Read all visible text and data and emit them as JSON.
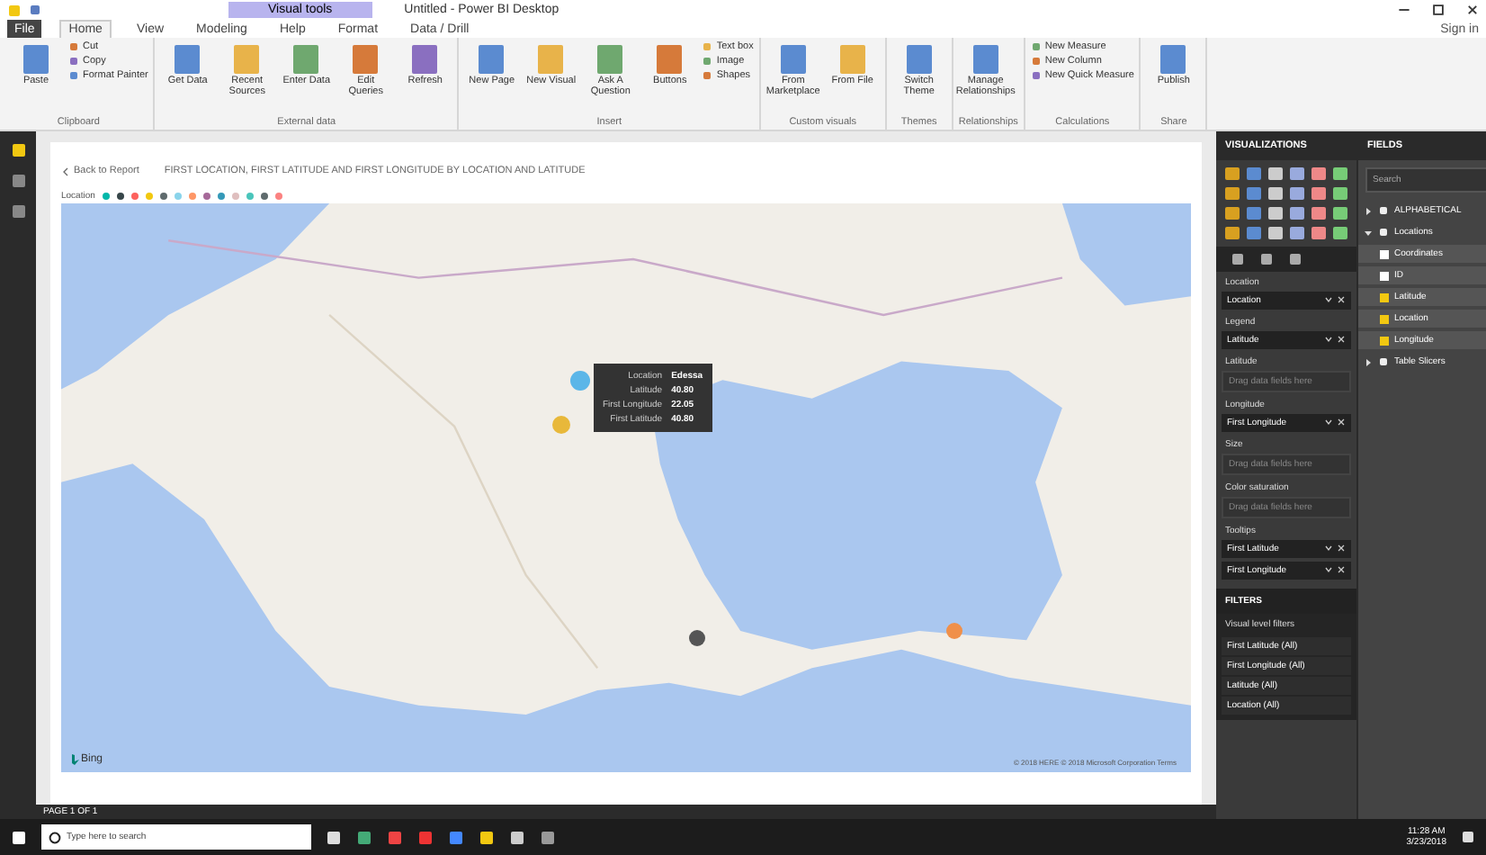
{
  "window": {
    "title": "Untitled - Power BI Desktop",
    "context_tab": "Visual tools",
    "sign_in": "Sign in"
  },
  "tabs": [
    {
      "label": "File",
      "selected": false
    },
    {
      "label": "Home",
      "selected": true
    },
    {
      "label": "View",
      "selected": false
    },
    {
      "label": "Modeling",
      "selected": false
    },
    {
      "label": "Help",
      "selected": false
    },
    {
      "label": "Format",
      "selected": false
    },
    {
      "label": "Data / Drill",
      "selected": false
    }
  ],
  "ribbon": [
    {
      "name": "Clipboard",
      "buttons": [
        {
          "label": "Paste",
          "kind": "large"
        },
        {
          "label": "Cut",
          "kind": "small"
        },
        {
          "label": "Copy",
          "kind": "small"
        },
        {
          "label": "Format Painter",
          "kind": "small"
        }
      ]
    },
    {
      "name": "External data",
      "buttons": [
        {
          "label": "Get Data",
          "kind": "large"
        },
        {
          "label": "Recent Sources",
          "kind": "large"
        },
        {
          "label": "Enter Data",
          "kind": "large"
        },
        {
          "label": "Edit Queries",
          "kind": "large"
        },
        {
          "label": "Refresh",
          "kind": "large"
        }
      ]
    },
    {
      "name": "Insert",
      "buttons": [
        {
          "label": "New Page",
          "kind": "large"
        },
        {
          "label": "New Visual",
          "kind": "large"
        },
        {
          "label": "Ask A Question",
          "kind": "large"
        },
        {
          "label": "Buttons",
          "kind": "large"
        },
        {
          "label": "Text box",
          "kind": "small"
        },
        {
          "label": "Image",
          "kind": "small"
        },
        {
          "label": "Shapes",
          "kind": "small"
        }
      ]
    },
    {
      "name": "Custom visuals",
      "buttons": [
        {
          "label": "From Marketplace",
          "kind": "large"
        },
        {
          "label": "From File",
          "kind": "large"
        }
      ]
    },
    {
      "name": "Themes",
      "buttons": [
        {
          "label": "Switch Theme",
          "kind": "large"
        }
      ]
    },
    {
      "name": "Relationships",
      "buttons": [
        {
          "label": "Manage Relationships",
          "kind": "large"
        }
      ]
    },
    {
      "name": "Calculations",
      "buttons": [
        {
          "label": "New Measure",
          "kind": "small"
        },
        {
          "label": "New Column",
          "kind": "small"
        },
        {
          "label": "New Quick Measure",
          "kind": "small"
        }
      ]
    },
    {
      "name": "Share",
      "buttons": [
        {
          "label": "Publish",
          "kind": "large"
        }
      ]
    }
  ],
  "report": {
    "back": "Back to Report",
    "title": "FIRST LOCATION, FIRST LATITUDE AND FIRST LONGITUDE BY LOCATION AND LATITUDE",
    "legend": {
      "label": "Location",
      "items": [
        {
          "color": "#01b8aa"
        },
        {
          "color": "#374649"
        },
        {
          "color": "#fd625e"
        },
        {
          "color": "#f2c80f"
        },
        {
          "color": "#5f6b6d"
        },
        {
          "color": "#8ad4eb"
        },
        {
          "color": "#fe9666"
        },
        {
          "color": "#a66999"
        },
        {
          "color": "#3599b8"
        },
        {
          "color": "#dfbfbf"
        },
        {
          "color": "#4ac5bb"
        },
        {
          "color": "#5f6b6d"
        },
        {
          "color": "#fb8281"
        }
      ]
    },
    "points": [
      {
        "color": "#5bb6e8"
      },
      {
        "color": "#e8b83a"
      },
      {
        "color": "#555555"
      },
      {
        "color": "#f0904a"
      }
    ],
    "tooltip": [
      {
        "label": "Location",
        "value": "Edessa"
      },
      {
        "label": "Latitude",
        "value": "40.80"
      },
      {
        "label": "First Longitude",
        "value": "22.05"
      },
      {
        "label": "First Latitude",
        "value": "40.80"
      }
    ],
    "bing": "Bing",
    "copyright": "© 2018 HERE © 2018 Microsoft Corporation Terms"
  },
  "status_bar": "PAGE 1 OF 1",
  "visualizations": {
    "title": "VISUALIZATIONS",
    "wells": [
      {
        "kind": "header",
        "text": "Location"
      },
      {
        "kind": "field",
        "text": "Location"
      },
      {
        "kind": "header",
        "text": "Legend"
      },
      {
        "kind": "field",
        "text": "Latitude"
      },
      {
        "kind": "header",
        "text": "Latitude"
      },
      {
        "kind": "empty",
        "text": "Drag data fields here"
      },
      {
        "kind": "header",
        "text": "Longitude"
      },
      {
        "kind": "field",
        "text": "First Longitude"
      },
      {
        "kind": "header",
        "text": "Size"
      },
      {
        "kind": "empty",
        "text": "Drag data fields here"
      },
      {
        "kind": "header",
        "text": "Color saturation"
      },
      {
        "kind": "empty",
        "text": "Drag data fields here"
      },
      {
        "kind": "header",
        "text": "Tooltips"
      },
      {
        "kind": "field",
        "text": "First Latitude"
      },
      {
        "kind": "field",
        "text": "First Longitude"
      }
    ]
  },
  "filters": {
    "title": "FILTERS",
    "section": "Visual level filters",
    "items": [
      "First Latitude (All)",
      "First Longitude (All)",
      "Latitude (All)",
      "Location (All)"
    ]
  },
  "fields": {
    "title": "FIELDS",
    "search": {
      "placeholder": "Search"
    },
    "tables": [
      {
        "name": "ALPHABETICAL",
        "expanded": false
      },
      {
        "name": "Locations",
        "expanded": true,
        "children": [
          {
            "name": "Coordinates",
            "checked": false
          },
          {
            "name": "ID",
            "checked": false
          },
          {
            "name": "Latitude",
            "checked": true
          },
          {
            "name": "Location",
            "checked": true
          },
          {
            "name": "Longitude",
            "checked": true
          }
        ]
      },
      {
        "name": "Table Slicers",
        "expanded": false
      }
    ]
  },
  "taskbar": {
    "search": {
      "placeholder": "Type here to search"
    },
    "time": "11:28 AM",
    "date": "3/23/2018"
  }
}
